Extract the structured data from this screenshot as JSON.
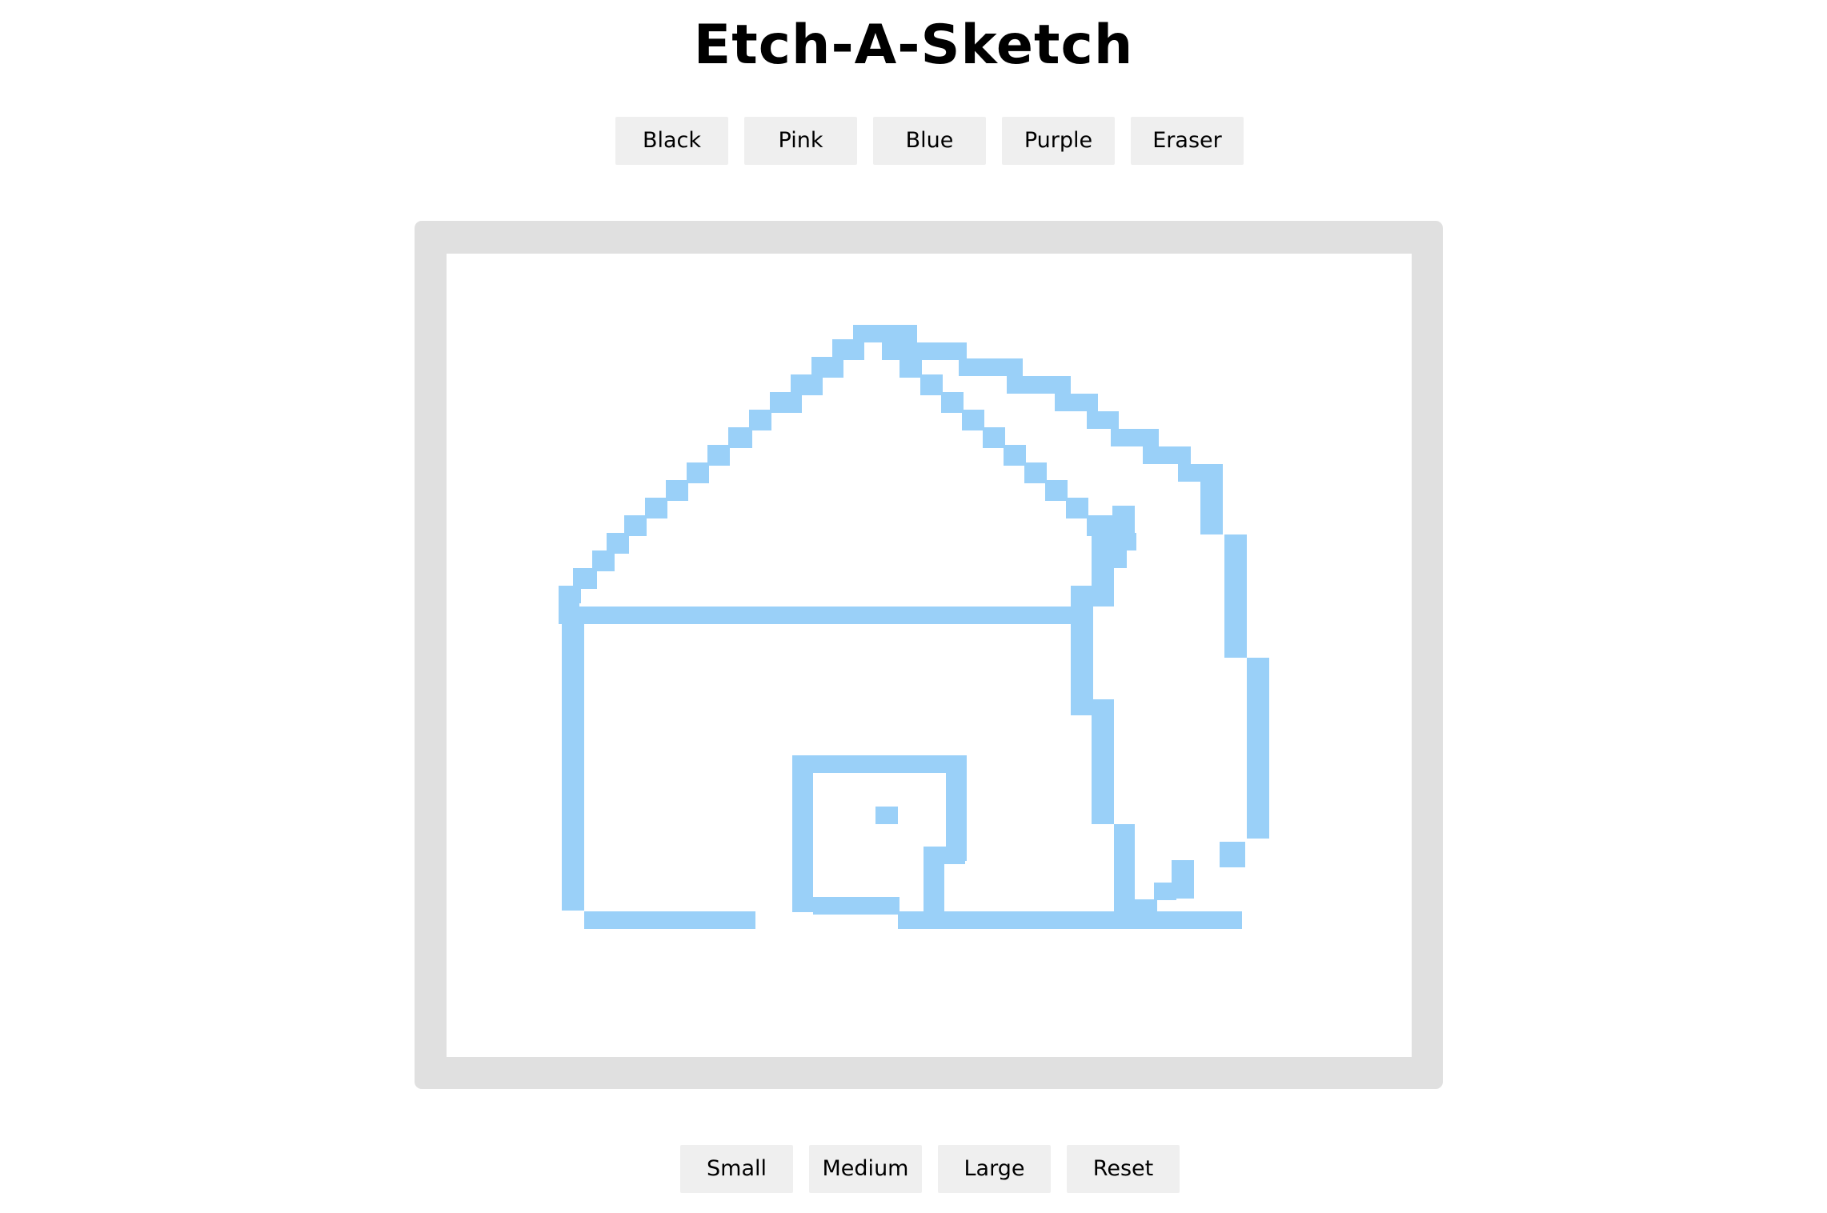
{
  "title": "Etch-A-Sketch",
  "color_buttons": [
    "Black",
    "Pink",
    "Blue",
    "Purple",
    "Eraser"
  ],
  "size_buttons": [
    "Small",
    "Medium",
    "Large",
    "Reset"
  ],
  "colors": {
    "page_background": "#ffffff",
    "button_background": "#efefef",
    "frame": "#e0e0e0",
    "sketch_area": "#ffffff",
    "drawn_pixels": "#9ad0f8"
  },
  "sketch": {
    "description_note": "pixel drawing of a house in light blue on a white grid",
    "grid_columns": 45,
    "grid_rows": 37
  }
}
